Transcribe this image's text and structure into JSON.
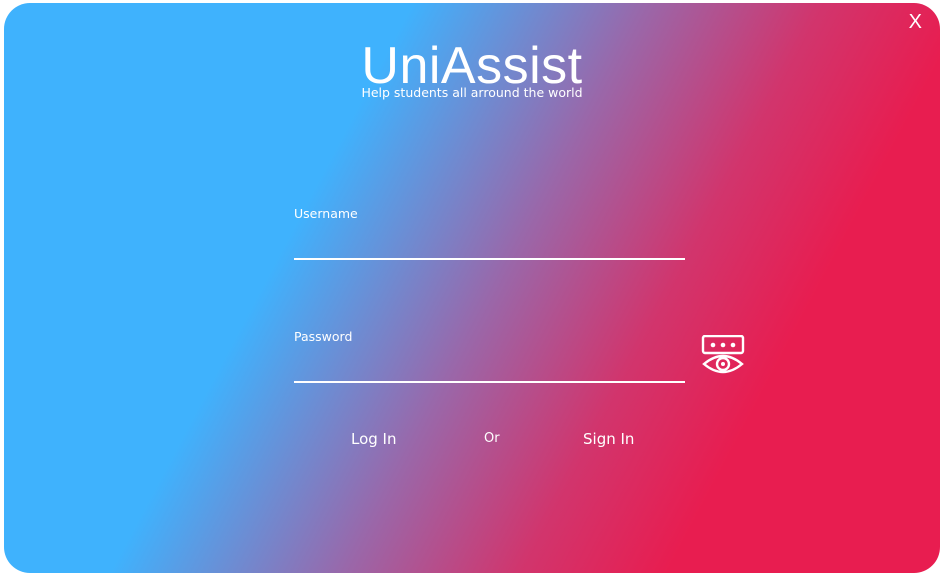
{
  "window": {
    "close_label": "X"
  },
  "brand": {
    "title": "UniAssist",
    "subtitle": "Help students all arround the world"
  },
  "form": {
    "username_label": "Username",
    "username_value": "",
    "password_label": "Password",
    "password_value": "",
    "show_password_icon": "eye-reveal-icon"
  },
  "actions": {
    "login_label": "Log In",
    "or_label": "Or",
    "signin_label": "Sign In"
  },
  "colors": {
    "gradient_start": "#3fb2fd",
    "gradient_mid": "#9a67a9",
    "gradient_end": "#e81d50",
    "text": "#ffffff"
  }
}
